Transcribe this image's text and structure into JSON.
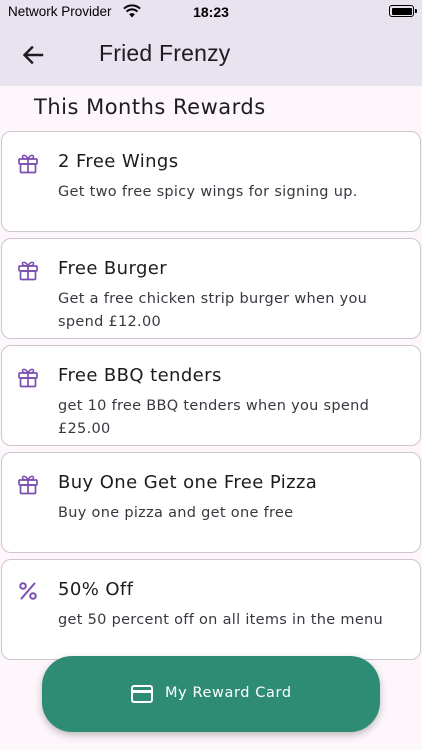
{
  "status_bar": {
    "carrier": "Network Provider",
    "time": "18:23"
  },
  "app_bar": {
    "title": "Fried Frenzy",
    "back_icon": "arrow-back-icon"
  },
  "section": {
    "title": "This Months Rewards"
  },
  "rewards": [
    {
      "icon": "gift-icon",
      "title": "2 Free Wings",
      "description": "Get two free spicy wings for signing up."
    },
    {
      "icon": "gift-icon",
      "title": "Free Burger",
      "description": "Get a free chicken strip burger when you spend £12.00"
    },
    {
      "icon": "gift-icon",
      "title": "Free BBQ tenders",
      "description": "get 10 free BBQ tenders when you spend £25.00"
    },
    {
      "icon": "gift-icon",
      "title": "Buy One Get one Free Pizza",
      "description": "Buy one pizza and get one free"
    },
    {
      "icon": "percent-icon",
      "title": "50% Off",
      "description": "get 50 percent  off on all items in the menu"
    }
  ],
  "fab": {
    "label": "My Reward Card",
    "icon": "credit-card-icon"
  },
  "colors": {
    "accent": "#7b4fb0",
    "fab": "#2e8b74",
    "app_bar": "#e9e2ef",
    "background": "#fdf6fb"
  }
}
